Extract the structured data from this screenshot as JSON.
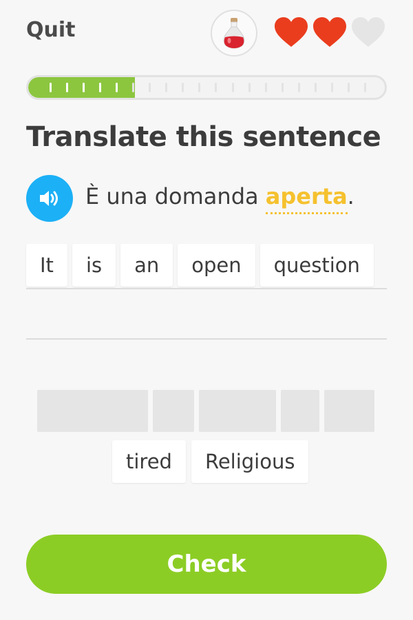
{
  "header": {
    "quit_label": "Quit",
    "potion_icon": "potion-icon",
    "hearts": [
      {
        "state": "full",
        "color": "#ea3d1e"
      },
      {
        "state": "full",
        "color": "#ea3d1e"
      },
      {
        "state": "empty",
        "color": "#e5e5e5"
      }
    ]
  },
  "progress": {
    "completed_fraction": 0.3,
    "ticks_total": 20,
    "ticks_completed": 6,
    "color": "#8cc63f"
  },
  "instruction": "Translate this sentence",
  "prompt": {
    "speaker_icon": "speaker-icon",
    "text_before": "È una domanda ",
    "hint_word": "aperta",
    "text_after": ".",
    "accent_color": "#1cb0f6",
    "hint_color": "#f5c12e"
  },
  "answer_words": [
    "It",
    "is",
    "an",
    "open",
    "question"
  ],
  "word_bank": {
    "used_slots": 5,
    "available": [
      "tired",
      "Religious"
    ]
  },
  "check_label": "Check",
  "check_color": "#8ccd25"
}
